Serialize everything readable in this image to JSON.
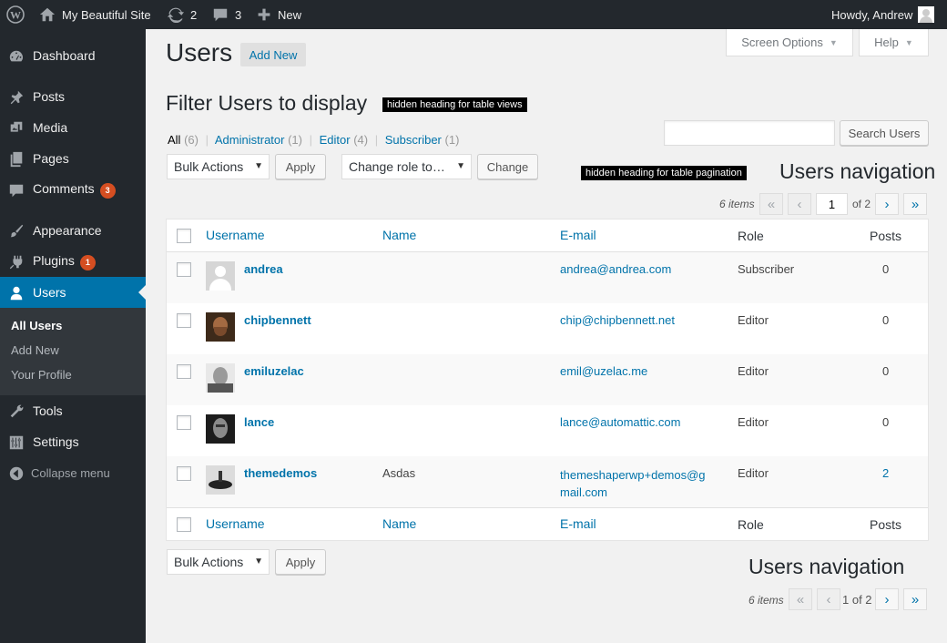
{
  "admin_bar": {
    "site_name": "My Beautiful Site",
    "updates_count": "2",
    "comments_count": "3",
    "new_label": "New",
    "greeting": "Howdy, Andrew"
  },
  "sidebar": {
    "items": [
      {
        "label": "Dashboard",
        "icon": "dashboard-icon"
      },
      {
        "label": "Posts",
        "icon": "pin-icon"
      },
      {
        "label": "Media",
        "icon": "media-icon"
      },
      {
        "label": "Pages",
        "icon": "pages-icon"
      },
      {
        "label": "Comments",
        "icon": "comments-icon",
        "badge": "3"
      },
      {
        "label": "Appearance",
        "icon": "brush-icon"
      },
      {
        "label": "Plugins",
        "icon": "plugin-icon",
        "badge": "1"
      },
      {
        "label": "Users",
        "icon": "user-icon"
      },
      {
        "label": "Tools",
        "icon": "wrench-icon"
      },
      {
        "label": "Settings",
        "icon": "sliders-icon"
      },
      {
        "label": "Collapse menu",
        "icon": "collapse-icon"
      }
    ],
    "submenu": [
      "All Users",
      "Add New",
      "Your Profile"
    ]
  },
  "header": {
    "title": "Users",
    "add_new": "Add New",
    "screen_options": "Screen Options",
    "help": "Help"
  },
  "filter": {
    "heading": "Filter Users to display",
    "hidden_heading_views": "hidden heading for table views",
    "views": [
      {
        "label": "All",
        "count": "(6)"
      },
      {
        "label": "Administrator",
        "count": "(1)"
      },
      {
        "label": "Editor",
        "count": "(4)"
      },
      {
        "label": "Subscriber",
        "count": "(1)"
      }
    ],
    "search_button": "Search Users",
    "search_value": ""
  },
  "actions": {
    "bulk_actions": "Bulk Actions",
    "apply": "Apply",
    "change_role": "Change role to…",
    "change": "Change"
  },
  "pagination": {
    "hidden_heading": "hidden heading for table pagination",
    "nav_heading": "Users navigation",
    "items": "6 items",
    "current_page": "1",
    "of_total": "of 2",
    "bottom_page": "1 of 2",
    "first": "«",
    "prev": "‹",
    "next": "›",
    "last": "»"
  },
  "table": {
    "columns": [
      "Username",
      "Name",
      "E-mail",
      "Role",
      "Posts"
    ],
    "rows": [
      {
        "username": "andrea",
        "name": "",
        "email": "andrea@andrea.com",
        "role": "Subscriber",
        "posts": "0"
      },
      {
        "username": "chipbennett",
        "name": "",
        "email": "chip@chipbennett.net",
        "role": "Editor",
        "posts": "0"
      },
      {
        "username": "emiluzelac",
        "name": "",
        "email": "emil@uzelac.me",
        "role": "Editor",
        "posts": "0"
      },
      {
        "username": "lance",
        "name": "",
        "email": "lance@automattic.com",
        "role": "Editor",
        "posts": "0"
      },
      {
        "username": "themedemos",
        "name": "Asdas",
        "email_line1": "themeshaperwp+demos@g",
        "email_line2": "mail.com",
        "role": "Editor",
        "posts": "2"
      }
    ]
  },
  "colors": {
    "accent": "#0073aa",
    "admin_bar": "#23282d",
    "badge": "#d54e21"
  }
}
